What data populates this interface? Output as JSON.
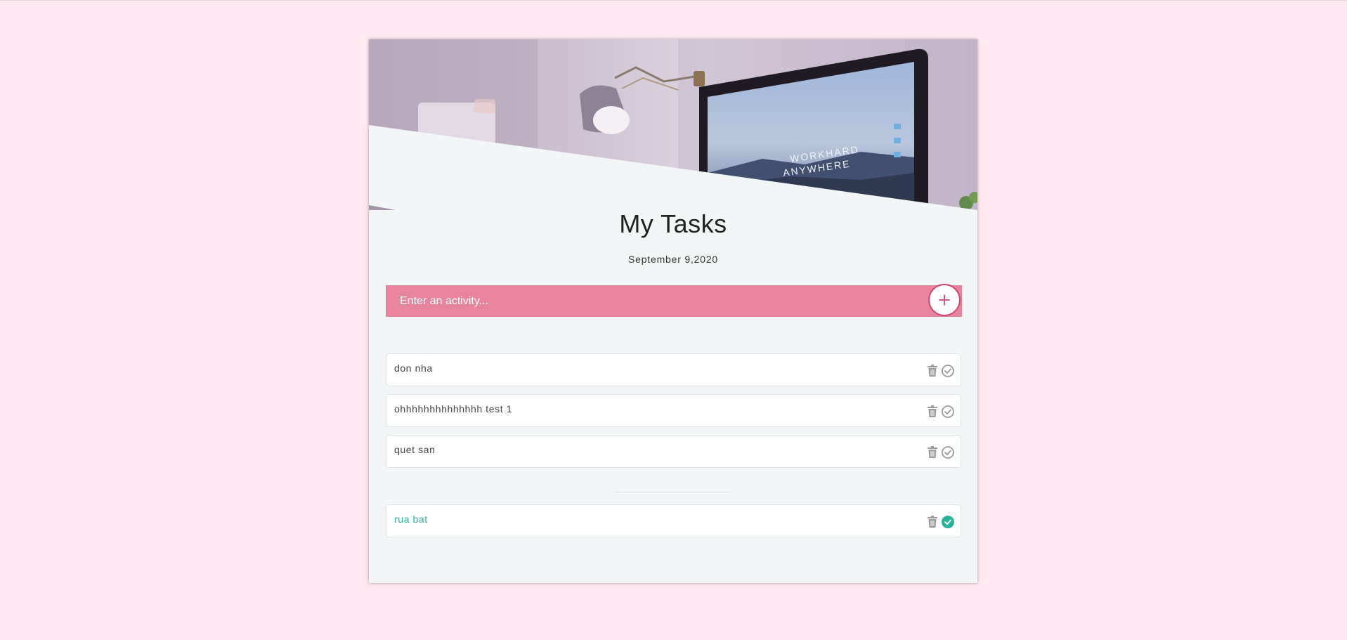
{
  "app": {
    "title": "My Tasks",
    "date": "September 9,2020"
  },
  "hero": {
    "screen_text_line1": "WORKHARD",
    "screen_text_line2": "ANYWHERE"
  },
  "add": {
    "placeholder": "Enter an activity...",
    "button_icon": "plus-icon"
  },
  "todo": [
    {
      "text": "don nha",
      "completed": false
    },
    {
      "text": "ohhhhhhhhhhhhhh test 1",
      "completed": false
    },
    {
      "text": "quet san",
      "completed": false
    }
  ],
  "completed": [
    {
      "text": "rua bat",
      "completed": true
    }
  ],
  "colors": {
    "background": "#ffe8ef",
    "accent": "#e8849e",
    "accent_dark": "#d8436f",
    "done": "#25b39a",
    "icon": "#9a9a9a"
  },
  "icons": {
    "delete": "trash-icon",
    "complete": "check-circle-icon"
  }
}
